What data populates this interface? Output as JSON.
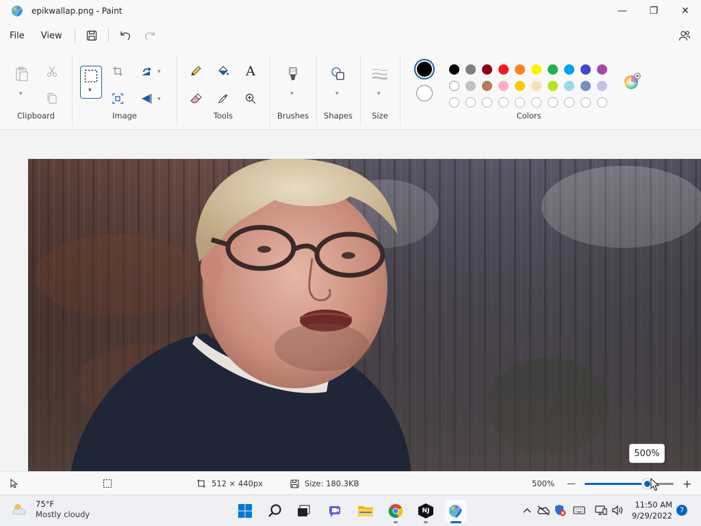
{
  "window": {
    "title": "epikwallap.png - Paint",
    "min_glyph": "—",
    "max_glyph": "❐",
    "close_glyph": "✕"
  },
  "menu": {
    "file": "File",
    "view": "View"
  },
  "ribbon": {
    "clipboard": "Clipboard",
    "image": "Image",
    "tools": "Tools",
    "brushes": "Brushes",
    "shapes": "Shapes",
    "size": "Size",
    "colors": "Colors",
    "text_tool_glyph": "A"
  },
  "palette": {
    "row1": [
      "#000000",
      "#7f7f7f",
      "#880015",
      "#ed1c24",
      "#ff7f27",
      "#fff200",
      "#22b14c",
      "#00a2e8",
      "#3f48cc",
      "#a349a4"
    ],
    "row2": [
      "#ffffff",
      "#c3c3c3",
      "#b97a57",
      "#ffaec9",
      "#ffc90e",
      "#efe4b0",
      "#b5e61d",
      "#99d9ea",
      "#7092be",
      "#c8bfe7"
    ],
    "primary": "#000000",
    "secondary": "#ffffff",
    "accent": "#0067c0"
  },
  "status": {
    "dimensions": "512 × 440px",
    "size": "Size: 180.3KB",
    "zoom": "500%",
    "zoom_tooltip": "500%",
    "zoom_minus": "—",
    "zoom_plus": "+",
    "zoom_level": 0.7
  },
  "taskbar": {
    "temperature": "75°F",
    "weather": "Mostly cloudy",
    "time": "11:50 AM",
    "date": "9/29/2022",
    "notifications": "7",
    "nj_label": "NJ"
  }
}
